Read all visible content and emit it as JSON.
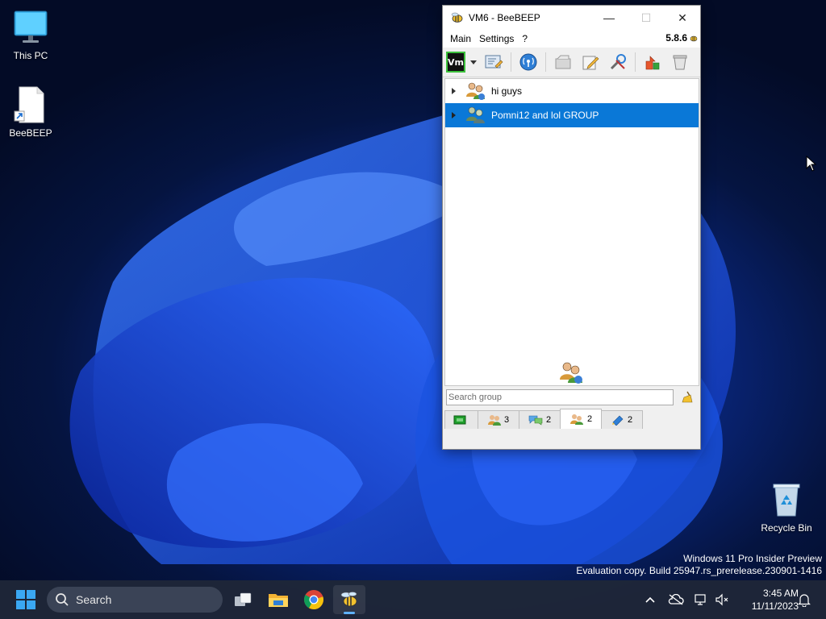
{
  "desktop": {
    "icons": [
      {
        "label": "This PC"
      },
      {
        "label": "BeeBEEP"
      },
      {
        "label": "Recycle Bin"
      }
    ],
    "watermark": {
      "line1": "Windows 11 Pro Insider Preview",
      "line2": "Evaluation copy. Build 25947.rs_prerelease.230901-1416"
    }
  },
  "window": {
    "title": "VM6 - BeeBEEP",
    "controls": {
      "minimize": "—",
      "maximize": "☐",
      "close": "✕"
    },
    "menu": [
      "Main",
      "Settings",
      "?"
    ],
    "version": "5.8.6",
    "toolbar": {
      "status_badge": "Vm",
      "buttons": [
        "edit-profile-icon",
        "network-icon",
        "folder-icon",
        "edit-icon",
        "tools-icon",
        "update-icon",
        "trash-icon"
      ]
    },
    "groups": [
      {
        "name": "hi guys",
        "selected": false
      },
      {
        "name": "Pomni12 and lol GROUP",
        "selected": true
      }
    ],
    "search": {
      "placeholder": "Search group",
      "value": ""
    },
    "tabs": [
      {
        "icon": "home-tab-icon",
        "count": ""
      },
      {
        "icon": "users-icon",
        "count": "3"
      },
      {
        "icon": "chats-icon",
        "count": "2"
      },
      {
        "icon": "groups-icon",
        "count": "2",
        "active": true
      },
      {
        "icon": "files-icon",
        "count": "2"
      }
    ]
  },
  "taskbar": {
    "search_label": "Search",
    "apps": [
      "task-view-icon",
      "file-explorer-icon",
      "chrome-icon",
      "beebeep-icon"
    ],
    "clock": {
      "time": "3:45 AM",
      "date": "11/11/2023"
    }
  },
  "colors": {
    "selection": "#0a78d7",
    "taskbar": "#1e2638",
    "accent": "#5fb2ff"
  }
}
